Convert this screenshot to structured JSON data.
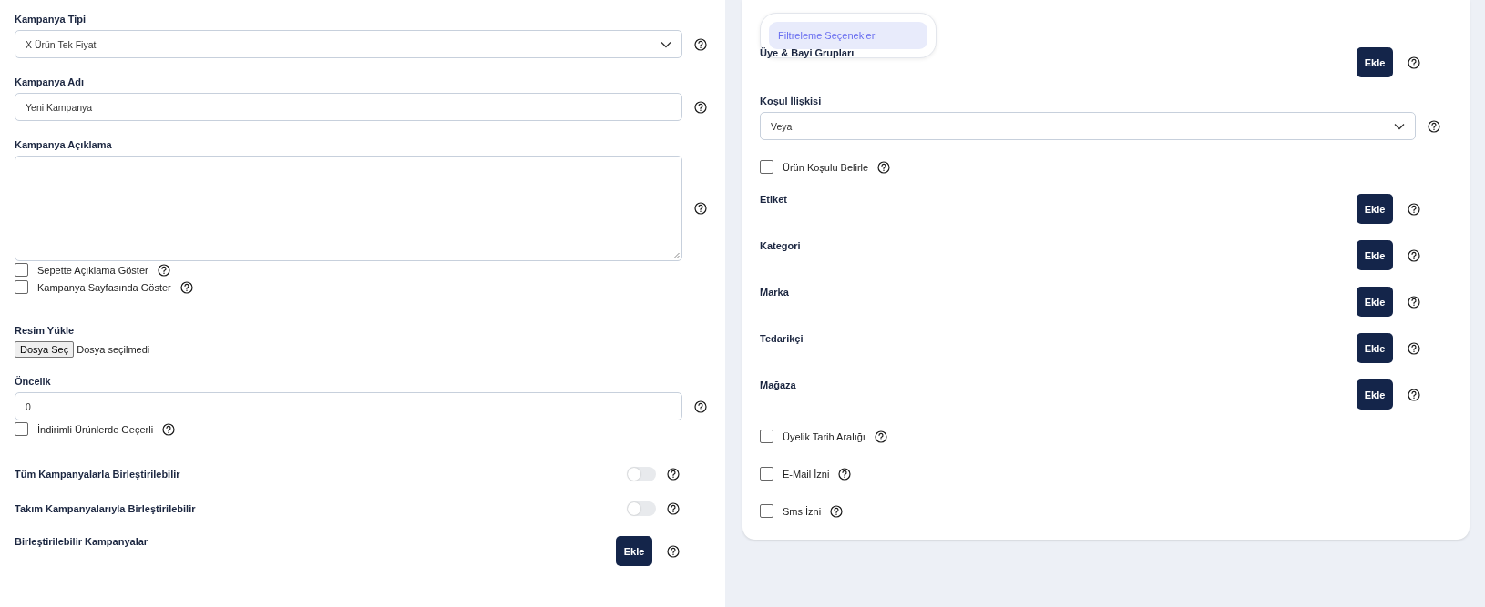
{
  "left": {
    "items": [
      {
        "kind": "select",
        "label": "Kampanya Tipi",
        "value": "X Ürün Tek Fiyat"
      },
      {
        "kind": "input",
        "label": "Kampanya Adı",
        "value": "Yeni Kampanya"
      },
      {
        "kind": "textarea",
        "label": "Kampanya Açıklama"
      },
      {
        "kind": "checkbox",
        "label": "Sepette Açıklama Göster",
        "checked": false
      },
      {
        "kind": "checkbox",
        "label": "Kampanya Sayfasında Göster",
        "checked": false
      },
      {
        "kind": "file",
        "label": "Resim Yükle",
        "button": "Dosya Seç",
        "status": "Dosya seçilmedi"
      },
      {
        "kind": "input",
        "label": "Öncelik",
        "value": "0"
      },
      {
        "kind": "checkbox",
        "label": "İndirimli Ürünlerde Geçerli",
        "checked": false
      },
      {
        "kind": "toggle",
        "label": "Tüm Kampanyalarla Birleştirilebilir",
        "on": false
      },
      {
        "kind": "toggle",
        "label": "Takım Kampanyalarıyla Birleştirilebilir",
        "on": false
      },
      {
        "kind": "add",
        "label": "Birleştirilebilir Kampanyalar",
        "button": "Ekle"
      }
    ]
  },
  "right": {
    "tab": {
      "label": "Filtreleme Seçenekleri",
      "selected": true
    },
    "items": [
      {
        "kind": "add",
        "label": "Üye & Bayi Grupları",
        "button": "Ekle"
      },
      {
        "kind": "select",
        "label": "Koşul İlişkisi",
        "value": "Veya"
      },
      {
        "kind": "checkbox",
        "label": "Ürün Koşulu Belirle",
        "checked": false
      },
      {
        "kind": "add",
        "label": "Etiket",
        "button": "Ekle"
      },
      {
        "kind": "add",
        "label": "Kategori",
        "button": "Ekle"
      },
      {
        "kind": "add",
        "label": "Marka",
        "button": "Ekle"
      },
      {
        "kind": "add",
        "label": "Tedarikçi",
        "button": "Ekle"
      },
      {
        "kind": "add",
        "label": "Mağaza",
        "button": "Ekle"
      },
      {
        "kind": "checkbox",
        "label": "Üyelik Tarih Aralığı",
        "checked": false
      },
      {
        "kind": "checkbox",
        "label": "E-Mail İzni",
        "checked": false
      },
      {
        "kind": "checkbox",
        "label": "Sms İzni",
        "checked": false
      }
    ]
  }
}
